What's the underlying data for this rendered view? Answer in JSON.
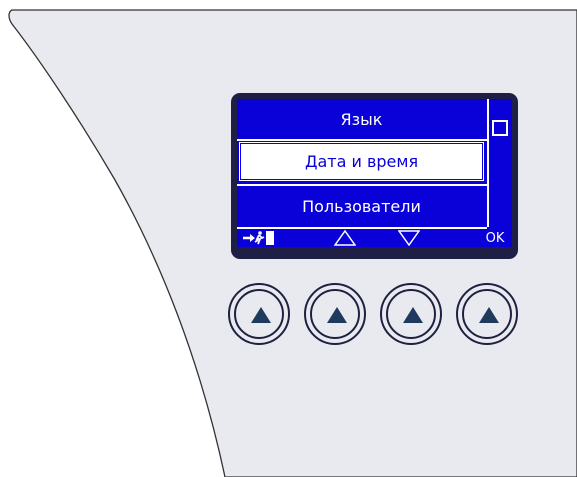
{
  "panel": {
    "colors": {
      "panel_fill": "#e8eaf0",
      "panel_edge": "#333333",
      "lcd_bezel": "#1f1f45",
      "lcd_background": "#0a00d8",
      "lcd_foreground": "#ffffff",
      "button_arrow": "#1f3a5c"
    }
  },
  "lcd": {
    "menu_items": [
      {
        "label": "Язык",
        "selected": false
      },
      {
        "label": "Дата и время",
        "selected": true
      },
      {
        "label": "Пользователи",
        "selected": false
      }
    ],
    "softkeys": {
      "exit_icon": "exit-running-man-icon",
      "up_icon": "triangle-up-outline-icon",
      "down_icon": "triangle-down-outline-icon",
      "ok_label": "OK"
    },
    "scrollbar_icon": "scroll-thumb-square-icon"
  },
  "buttons": [
    {
      "icon": "triangle-up-filled-icon"
    },
    {
      "icon": "triangle-up-filled-icon"
    },
    {
      "icon": "triangle-up-filled-icon"
    },
    {
      "icon": "triangle-up-filled-icon"
    }
  ]
}
